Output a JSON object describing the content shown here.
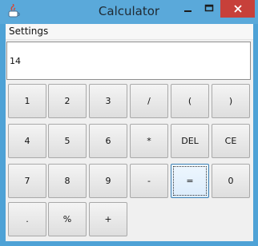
{
  "window": {
    "title": "Calculator"
  },
  "menu": {
    "settings_label": "Settings"
  },
  "display": {
    "value": "14"
  },
  "keys": [
    [
      "1",
      "2",
      "3",
      "/",
      "(",
      ")"
    ],
    [
      "4",
      "5",
      "6",
      "*",
      "DEL",
      "CE"
    ],
    [
      "7",
      "8",
      "9",
      "-",
      "=",
      "0"
    ],
    [
      ".",
      "%",
      "+"
    ]
  ],
  "focused_key": "=",
  "colors": {
    "titlebar": "#5aa9da",
    "close_button": "#c7403a",
    "client_bg": "#f0f0f0",
    "display_bg": "#ffffff",
    "focused_key_bg": "#dcecfb"
  },
  "icons": {
    "app": "java-app-icon",
    "minimize": "minimize-icon",
    "maximize": "maximize-icon",
    "close": "close-icon"
  }
}
